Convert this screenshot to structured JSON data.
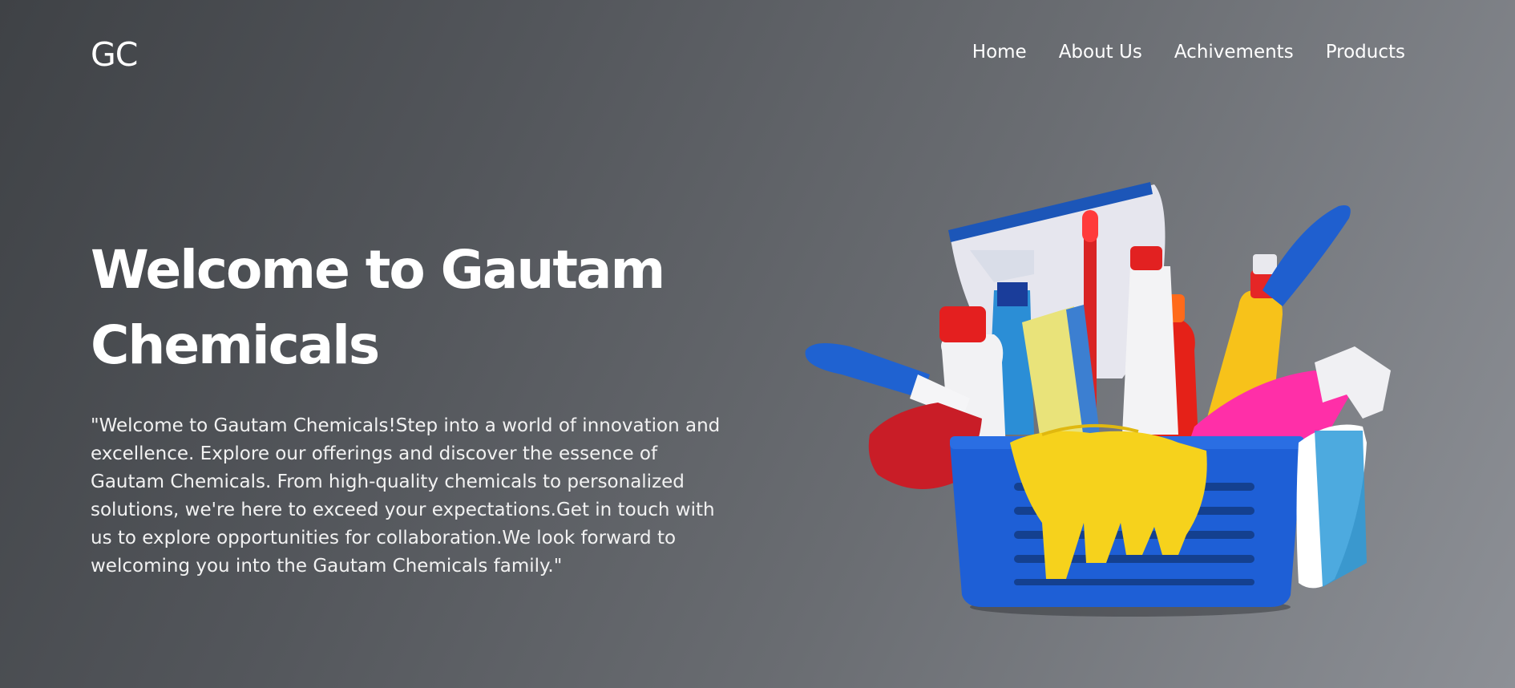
{
  "navbar": {
    "logo": "GC",
    "links": [
      "Home",
      "About Us",
      "Achivements",
      "Products"
    ]
  },
  "hero": {
    "title": "Welcome to Gautam Chemicals",
    "description": "\"Welcome to Gautam Chemicals!Step into a world of innovation and excellence. Explore our offerings and discover the essence of Gautam Chemicals. From high-quality chemicals to personalized solutions, we're here to exceed your expectations.Get in touch with us to explore opportunities for collaboration.We look forward to welcoming you into the Gautam Chemicals family.\""
  },
  "colors": {
    "background_dark": "#3f4246",
    "background_light": "#8d9096",
    "text": "#ffffff",
    "basket_blue": "#1e5fd6",
    "glove_yellow": "#f6d21c",
    "accent_red": "#e21d1d",
    "accent_pink": "#ff2fa8"
  },
  "icons": {
    "hero_image": "cleaning-supplies-basket-illustration"
  }
}
